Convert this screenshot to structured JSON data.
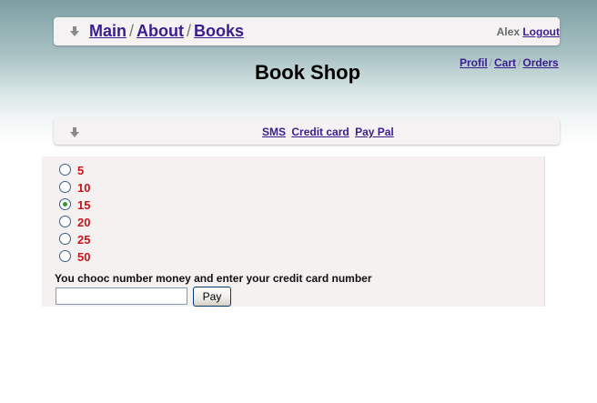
{
  "breadcrumb": {
    "items": [
      "Main",
      "About",
      "Books"
    ],
    "separator": "/"
  },
  "user": {
    "name": "Alex",
    "logout": "Logout",
    "links": [
      "Profil",
      "Cart",
      "Orders"
    ],
    "links_separator": "/"
  },
  "page": {
    "title": "Book Shop"
  },
  "payment_methods": [
    "SMS",
    "Credit card",
    "Pay Pal"
  ],
  "amounts": {
    "options": [
      "5",
      "10",
      "15",
      "20",
      "25",
      "50"
    ],
    "selected": "15"
  },
  "form": {
    "instruction": "You chooc number money and enter your credit card number",
    "card_value": "",
    "pay_label": "Pay"
  },
  "colors": {
    "link": "#3a1d8f",
    "amount_text": "#c9141b",
    "radio_selected": "#2c9a2c"
  },
  "icons": {
    "bar_marker": "down-arrow-icon"
  }
}
